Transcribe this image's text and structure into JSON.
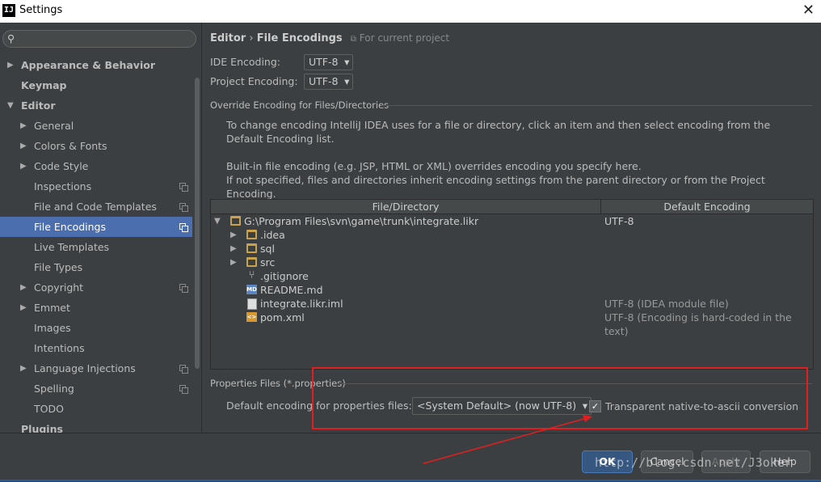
{
  "window": {
    "title": "Settings",
    "icon_text": "IJ"
  },
  "search": {
    "placeholder": ""
  },
  "sidebar": {
    "items": [
      {
        "label": "Appearance & Behavior"
      },
      {
        "label": "Keymap"
      },
      {
        "label": "Editor"
      },
      {
        "label": "General"
      },
      {
        "label": "Colors & Fonts"
      },
      {
        "label": "Code Style"
      },
      {
        "label": "Inspections"
      },
      {
        "label": "File and Code Templates"
      },
      {
        "label": "File Encodings"
      },
      {
        "label": "Live Templates"
      },
      {
        "label": "File Types"
      },
      {
        "label": "Copyright"
      },
      {
        "label": "Emmet"
      },
      {
        "label": "Images"
      },
      {
        "label": "Intentions"
      },
      {
        "label": "Language Injections"
      },
      {
        "label": "Spelling"
      },
      {
        "label": "TODO"
      },
      {
        "label": "Plugins"
      }
    ]
  },
  "breadcrumb": {
    "parent": "Editor",
    "separator": "›",
    "current": "File Encodings",
    "scope": "For current project"
  },
  "ide_encoding": {
    "label": "IDE Encoding:",
    "value": "UTF-8"
  },
  "project_encoding": {
    "label": "Project Encoding:",
    "value": "UTF-8"
  },
  "override": {
    "title": "Override Encoding for Files/Directories",
    "help1": "To change encoding IntelliJ IDEA uses for a file or directory, click an item and then select encoding from the Default Encoding list.",
    "help2": "Built-in file encoding (e.g. JSP, HTML or XML) overrides encoding you specify here.",
    "help3": "If not specified, files and directories inherit encoding settings from the parent directory or from the Project Encoding."
  },
  "table": {
    "columns": [
      "File/Directory",
      "Default Encoding"
    ],
    "rows": [
      {
        "name": "G:\\Program Files\\svn\\game\\trunk\\integrate.likr",
        "encoding": "UTF-8",
        "icon": "folder-icon"
      },
      {
        "name": ".idea",
        "encoding": "",
        "icon": "folder-icon"
      },
      {
        "name": "sql",
        "encoding": "",
        "icon": "folder-icon"
      },
      {
        "name": "src",
        "encoding": "",
        "icon": "folder-icon"
      },
      {
        "name": ".gitignore",
        "encoding": "",
        "icon": "git-icon"
      },
      {
        "name": "README.md",
        "encoding": "",
        "icon": "markdown-icon"
      },
      {
        "name": "integrate.likr.iml",
        "encoding": "UTF-8 (IDEA module file)",
        "icon": "iml-file-icon"
      },
      {
        "name": "pom.xml",
        "encoding": "UTF-8 (Encoding is hard-coded in the text)",
        "icon": "xml-file-icon"
      }
    ]
  },
  "properties": {
    "title": "Properties Files (*.properties)",
    "default_label": "Default encoding for properties files:",
    "default_value": "<System Default> (now UTF-8)",
    "transparent_label": "Transparent native-to-ascii conversion",
    "transparent_checked": true
  },
  "buttons": {
    "ok": "OK",
    "cancel": "Cancel",
    "apply": "Apply",
    "help": "Help"
  },
  "watermark": "http://blog.csdn.net/J3oker",
  "colors": {
    "accent": "#4b6eaf",
    "highlight": "#e02020",
    "background": "#3c3f41"
  }
}
